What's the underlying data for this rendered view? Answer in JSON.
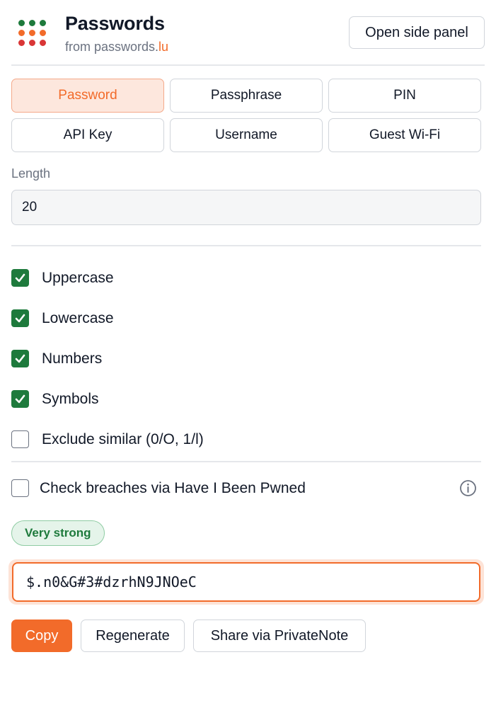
{
  "header": {
    "title": "Passwords",
    "subtitle_prefix": "from passwords.",
    "subtitle_accent": "lu",
    "side_panel_button": "Open side panel",
    "logo_dot_colors": [
      "#1e7a3c",
      "#1e7a3c",
      "#1e7a3c",
      "#f26b2a",
      "#f26b2a",
      "#f26b2a",
      "#d93636",
      "#d93636",
      "#d93636"
    ]
  },
  "modes": [
    {
      "label": "Password",
      "active": true
    },
    {
      "label": "Passphrase",
      "active": false
    },
    {
      "label": "PIN",
      "active": false
    },
    {
      "label": "API Key",
      "active": false
    },
    {
      "label": "Username",
      "active": false
    },
    {
      "label": "Guest Wi-Fi",
      "active": false
    }
  ],
  "length": {
    "label": "Length",
    "value": "20"
  },
  "options": [
    {
      "label": "Uppercase",
      "checked": true
    },
    {
      "label": "Lowercase",
      "checked": true
    },
    {
      "label": "Numbers",
      "checked": true
    },
    {
      "label": "Symbols",
      "checked": true
    },
    {
      "label": "Exclude similar (0/O, 1/l)",
      "checked": false
    }
  ],
  "breach_check": {
    "label": "Check breaches via Have I Been Pwned",
    "checked": false,
    "icon": "info-icon"
  },
  "strength": {
    "label": "Very strong"
  },
  "password": {
    "value": "$.n0&G#3#dzrhN9JNOeC"
  },
  "actions": {
    "copy": "Copy",
    "regenerate": "Regenerate",
    "share": "Share via PrivateNote"
  },
  "colors": {
    "accent": "#f26b2a",
    "success": "#1e7a3c",
    "accent_bg": "#fde7dd"
  }
}
